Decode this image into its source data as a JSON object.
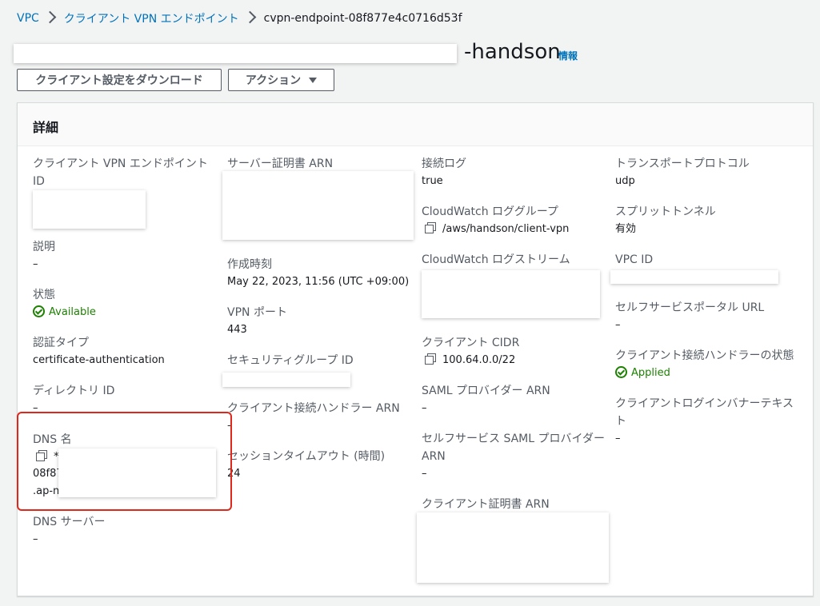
{
  "breadcrumb": {
    "vpc": "VPC",
    "endpoints": "クライアント VPN エンドポイント",
    "current": "cvpn-endpoint-08f877e4c0716d53f"
  },
  "header": {
    "title_visible": "-handson",
    "info": "情報"
  },
  "buttons": {
    "download": "クライアント設定をダウンロード",
    "actions": "アクション"
  },
  "panel": {
    "title": "詳細"
  },
  "details": {
    "col1": {
      "endpoint_id_label": "クライアント VPN エンドポイント ID",
      "description_label": "説明",
      "description_value": "–",
      "state_label": "状態",
      "state_value": "Available",
      "auth_type_label": "認証タイプ",
      "auth_type_value": "certificate-authentication",
      "directory_id_label": "ディレクトリ ID",
      "directory_id_value": "–",
      "dns_name_label": "DNS 名",
      "dns_name_line1": "*",
      "dns_name_line2": "08f87",
      "dns_name_line3": ".ap-n",
      "dns_server_label": "DNS サーバー",
      "dns_server_value": "–"
    },
    "col2": {
      "server_cert_label": "サーバー証明書 ARN",
      "created_label": "作成時刻",
      "created_value": "May 22, 2023, 11:56 (UTC +09:00)",
      "vpn_port_label": "VPN ポート",
      "vpn_port_value": "443",
      "security_group_label": "セキュリティグループ ID",
      "connect_handler_label": "クライアント接続ハンドラー ARN",
      "connect_handler_value": "–",
      "session_timeout_label": "セッションタイムアウト (時間)",
      "session_timeout_value": "24"
    },
    "col3": {
      "connection_log_label": "接続ログ",
      "connection_log_value": "true",
      "cw_log_group_label": "CloudWatch ロググループ",
      "cw_log_group_value": "/aws/handson/client-vpn",
      "cw_log_stream_label": "CloudWatch ログストリーム",
      "client_cidr_label": "クライアント CIDR",
      "client_cidr_value": "100.64.0.0/22",
      "saml_provider_label": "SAML プロバイダー ARN",
      "saml_provider_value": "–",
      "selfservice_saml_label_1": "セルフサービス SAML プロバイダー",
      "selfservice_saml_label_2": "ARN",
      "selfservice_saml_value": "–",
      "client_cert_label": "クライアント証明書 ARN"
    },
    "col4": {
      "transport_label": "トランスポートプロトコル",
      "transport_value": "udp",
      "split_tunnel_label": "スプリットトンネル",
      "split_tunnel_value": "有効",
      "vpc_id_label": "VPC ID",
      "selfservice_portal_label": "セルフサービスポータル URL",
      "selfservice_portal_value": "–",
      "handler_state_label": "クライアント接続ハンドラーの状態",
      "handler_state_value": "Applied",
      "banner_label_1": "クライアントログインバナーテキス",
      "banner_label_2": "ト",
      "banner_value": "–"
    }
  },
  "colors": {
    "link": "#0073bb",
    "success": "#1d8102",
    "highlight": "#e0271c"
  },
  "icons": {
    "copy": "copy-icon",
    "status": "check-circle-icon",
    "separator": "chevron-right-icon",
    "dropdown": "caret-down-icon"
  }
}
